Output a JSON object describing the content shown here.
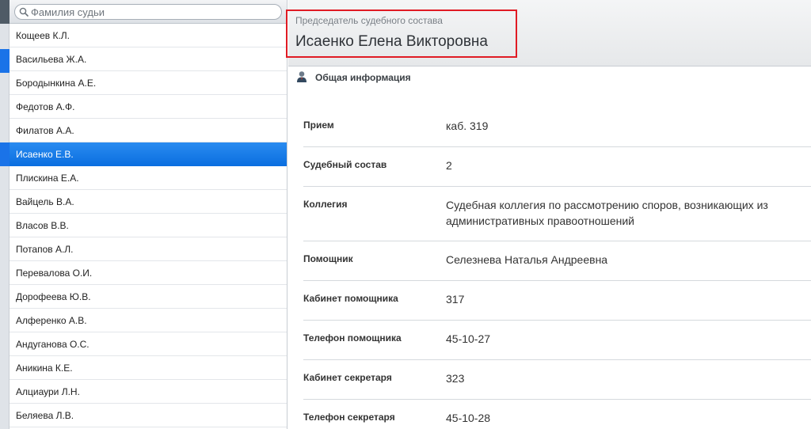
{
  "search": {
    "placeholder": "Фамилия судьи",
    "value": ""
  },
  "judges": [
    "Кощеев К.Л.",
    "Васильева Ж.А.",
    "Бородынкина А.Е.",
    "Федотов А.Ф.",
    "Филатов А.А.",
    "Исаенко Е.В.",
    "Плискина Е.А.",
    "Вайцель В.А.",
    "Власов В.В.",
    "Потапов А.Л.",
    "Перевалова О.И.",
    "Дорофеева Ю.В.",
    "Алференко А.В.",
    "Андуганова О.С.",
    "Аникина К.Е.",
    "Алциаури Л.Н.",
    "Беляева Л.В."
  ],
  "active_index": 5,
  "header": {
    "subtitle": "Председатель судебного состава",
    "title": "Исаенко Елена Викторовна"
  },
  "section": {
    "icon": "user-icon",
    "label": "Общая информация"
  },
  "info": [
    {
      "key": "Прием",
      "value": "каб. 319"
    },
    {
      "key": "Судебный состав",
      "value": "2"
    },
    {
      "key": "Коллегия",
      "value": "Судебная коллегия по рассмотрению споров, возникающих из административных правоотношений"
    },
    {
      "key": "Помощник",
      "value": "Селезнева Наталья Андреевна"
    },
    {
      "key": "Кабинет помощника",
      "value": "317"
    },
    {
      "key": "Телефон помощника",
      "value": "45-10-27"
    },
    {
      "key": "Кабинет секретаря",
      "value": "323"
    },
    {
      "key": "Телефон секретаря",
      "value": "45-10-28"
    }
  ],
  "colors": {
    "accent": "#1a73e8",
    "highlight": "#e01b24"
  }
}
